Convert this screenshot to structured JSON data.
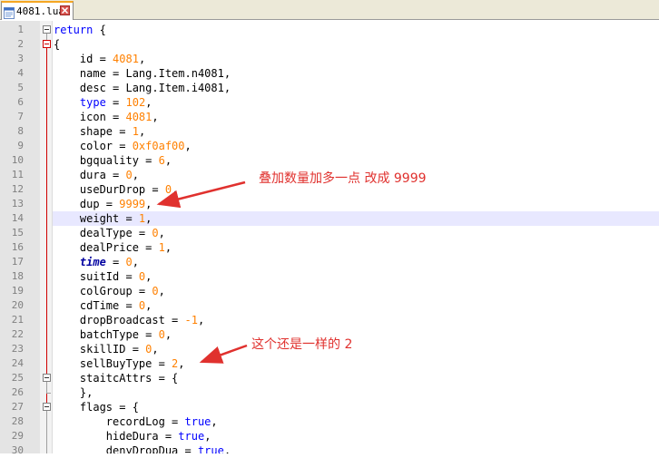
{
  "tab": {
    "label": "4081.lua",
    "icon": "lua-file-icon",
    "close_icon": "close-icon",
    "accent": "#f5a623"
  },
  "editor": {
    "lines": [
      {
        "n": "1",
        "code": "return {"
      },
      {
        "n": "2",
        "code": "{"
      },
      {
        "n": "3",
        "code": "    id = 4081,"
      },
      {
        "n": "4",
        "code": "    name = Lang.Item.n4081,"
      },
      {
        "n": "5",
        "code": "    desc = Lang.Item.i4081,"
      },
      {
        "n": "6",
        "code": "    type = 102,"
      },
      {
        "n": "7",
        "code": "    icon = 4081,"
      },
      {
        "n": "8",
        "code": "    shape = 1,"
      },
      {
        "n": "9",
        "code": "    color = 0xf0af00,"
      },
      {
        "n": "10",
        "code": "    bgquality = 6,"
      },
      {
        "n": "11",
        "code": "    dura = 0,"
      },
      {
        "n": "12",
        "code": "    useDurDrop = 0,"
      },
      {
        "n": "13",
        "code": "    dup = 9999,"
      },
      {
        "n": "14",
        "code": "    weight = 1,"
      },
      {
        "n": "15",
        "code": "    dealType = 0,"
      },
      {
        "n": "16",
        "code": "    dealPrice = 1,"
      },
      {
        "n": "17",
        "code": "    time = 0,"
      },
      {
        "n": "18",
        "code": "    suitId = 0,"
      },
      {
        "n": "19",
        "code": "    colGroup = 0,"
      },
      {
        "n": "20",
        "code": "    cdTime = 0,"
      },
      {
        "n": "21",
        "code": "    dropBroadcast = -1,"
      },
      {
        "n": "22",
        "code": "    batchType = 0,"
      },
      {
        "n": "23",
        "code": "    skillID = 0,"
      },
      {
        "n": "24",
        "code": "    sellBuyType = 2,"
      },
      {
        "n": "25",
        "code": "    staitcAttrs = {"
      },
      {
        "n": "26",
        "code": "    },"
      },
      {
        "n": "27",
        "code": "    flags = {"
      },
      {
        "n": "28",
        "code": "        recordLog = true,"
      },
      {
        "n": "29",
        "code": "        hideDura = true,"
      },
      {
        "n": "30",
        "code": "        denyDropDua = true,"
      }
    ],
    "current_line": 14
  },
  "annotations": [
    {
      "text": "叠加数量加多一点 改成 9999",
      "color": "#e0312e"
    },
    {
      "text": "这个还是一样的 2",
      "color": "#e0312e"
    }
  ]
}
